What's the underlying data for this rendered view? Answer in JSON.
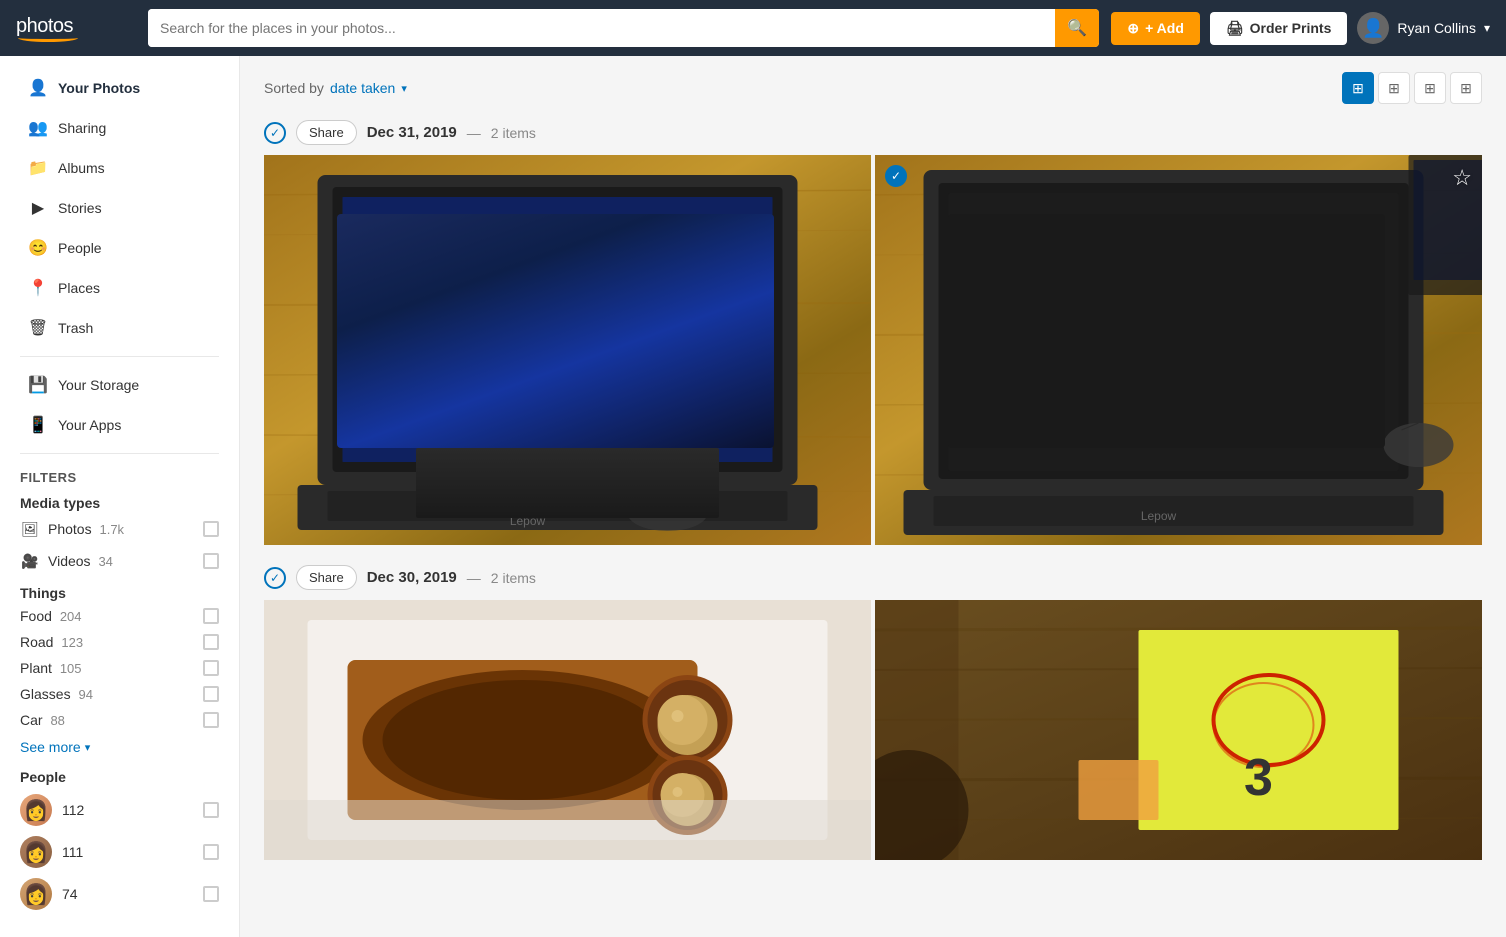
{
  "header": {
    "logo": "photos",
    "search_placeholder": "Search for the places in your photos...",
    "add_label": "+ Add",
    "order_prints_label": "Order Prints",
    "user_name": "Ryan Collins"
  },
  "sidebar": {
    "nav_items": [
      {
        "id": "your-photos",
        "label": "Your Photos",
        "icon": "👤",
        "active": true
      },
      {
        "id": "sharing",
        "label": "Sharing",
        "icon": "👥"
      },
      {
        "id": "albums",
        "label": "Albums",
        "icon": "📁"
      },
      {
        "id": "stories",
        "label": "Stories",
        "icon": "▶"
      },
      {
        "id": "people",
        "label": "People",
        "icon": "😊"
      },
      {
        "id": "places",
        "label": "Places",
        "icon": "📍"
      },
      {
        "id": "trash",
        "label": "Trash",
        "icon": "🗑"
      }
    ],
    "storage_label": "Your Storage",
    "apps_label": "Your Apps",
    "filters_label": "FILTERS",
    "media_types_label": "Media types",
    "media_types": [
      {
        "id": "photos",
        "icon": "🖼",
        "label": "Photos",
        "count": "1.7k"
      },
      {
        "id": "videos",
        "icon": "🎥",
        "label": "Videos",
        "count": "34"
      }
    ],
    "things_label": "Things",
    "things": [
      {
        "label": "Food",
        "count": "204"
      },
      {
        "label": "Road",
        "count": "123"
      },
      {
        "label": "Plant",
        "count": "105"
      },
      {
        "label": "Glasses",
        "count": "94"
      },
      {
        "label": "Car",
        "count": "88"
      }
    ],
    "see_more_label": "See more",
    "people_label": "People",
    "people_items": [
      {
        "count": "112"
      },
      {
        "count": "111"
      },
      {
        "count": "74"
      }
    ]
  },
  "content": {
    "sort_label": "Sorted by",
    "sort_value": "date taken",
    "date_groups": [
      {
        "date": "Dec 31, 2019",
        "count": "2 items",
        "share_label": "Share",
        "photos": [
          {
            "type": "laptop-blue",
            "starred": false
          },
          {
            "type": "laptop-terminal",
            "starred": true
          }
        ]
      },
      {
        "date": "Dec 30, 2019",
        "count": "2 items",
        "share_label": "Share",
        "photos": [
          {
            "type": "food",
            "starred": false
          },
          {
            "type": "note",
            "starred": false
          }
        ]
      }
    ]
  }
}
